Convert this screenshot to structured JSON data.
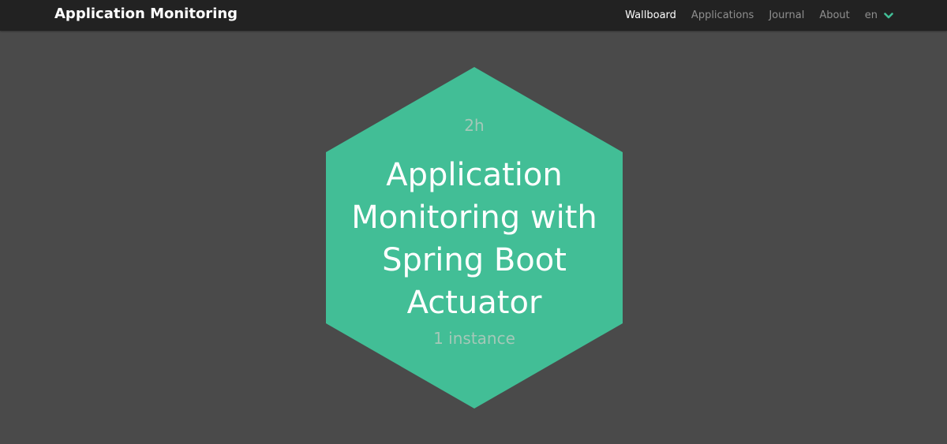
{
  "header": {
    "brand": "Application Monitoring",
    "nav": {
      "wallboard": "Wallboard",
      "applications": "Applications",
      "journal": "Journal",
      "about": "About",
      "language": "en"
    },
    "accent_color": "#42be96",
    "icons": {
      "language_toggle": "chevron-down-icon"
    }
  },
  "wallboard": {
    "applications": [
      {
        "name_lines": [
          "Application",
          "Monitoring with",
          "Spring Boot",
          "Actuator"
        ],
        "uptime": "2h",
        "instances": "1 instance",
        "status_color": "#42be96"
      }
    ]
  }
}
